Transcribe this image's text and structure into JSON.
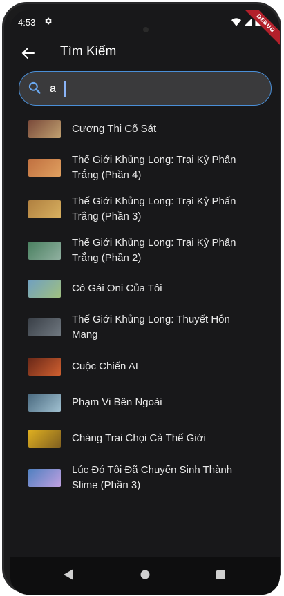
{
  "status_bar": {
    "time": "4:53",
    "debug_label": "DEBUG"
  },
  "app_bar": {
    "title": "Tìm Kiếm"
  },
  "search": {
    "value": "a",
    "accent_color": "#4a8fd8"
  },
  "results": [
    {
      "title_line1": "Cương Thi Cổ Sát",
      "title_line2": "",
      "thumb_color": "#7a4a3a",
      "thumb_color2": "#c0a070"
    },
    {
      "title_line1": "Thế Giới Khủng Long: Trại Kỷ Phấn",
      "title_line2": "Trắng (Phần 4)",
      "thumb_color": "#c07040",
      "thumb_color2": "#e0a060"
    },
    {
      "title_line1": "Thế Giới Khủng Long: Trại Kỷ Phấn",
      "title_line2": "Trắng (Phần 3)",
      "thumb_color": "#b08040",
      "thumb_color2": "#d8b060"
    },
    {
      "title_line1": "Thế Giới Khủng Long: Trại Kỷ Phấn",
      "title_line2": "Trắng (Phần 2)",
      "thumb_color": "#4a8060",
      "thumb_color2": "#90b0a0"
    },
    {
      "title_line1": "Cô Gái Oni Của Tôi",
      "title_line2": "",
      "thumb_color": "#70a0c0",
      "thumb_color2": "#a0c080"
    },
    {
      "title_line1": "Thế Giới Khủng Long: Thuyết Hỗn",
      "title_line2": "Mang",
      "thumb_color": "#3a4048",
      "thumb_color2": "#707880"
    },
    {
      "title_line1": "Cuộc Chiến AI",
      "title_line2": "",
      "thumb_color": "#6a2818",
      "thumb_color2": "#d06030"
    },
    {
      "title_line1": "Phạm Vi Bên Ngoài",
      "title_line2": "",
      "thumb_color": "#4a6a80",
      "thumb_color2": "#a0c0d0"
    },
    {
      "title_line1": "Chàng Trai Chọi Cả Thế Giới",
      "title_line2": "",
      "thumb_color": "#e0b020",
      "thumb_color2": "#806020"
    },
    {
      "title_line1": "Lúc Đó Tôi Đã Chuyển Sinh Thành",
      "title_line2": "Slime (Phần 3)",
      "thumb_color": "#5080c0",
      "thumb_color2": "#c0a0e0"
    }
  ],
  "icons": {
    "back": "arrow-left-icon",
    "search": "search-icon",
    "settings": "gear-icon",
    "wifi": "wifi-icon",
    "battery": "battery-icon"
  }
}
